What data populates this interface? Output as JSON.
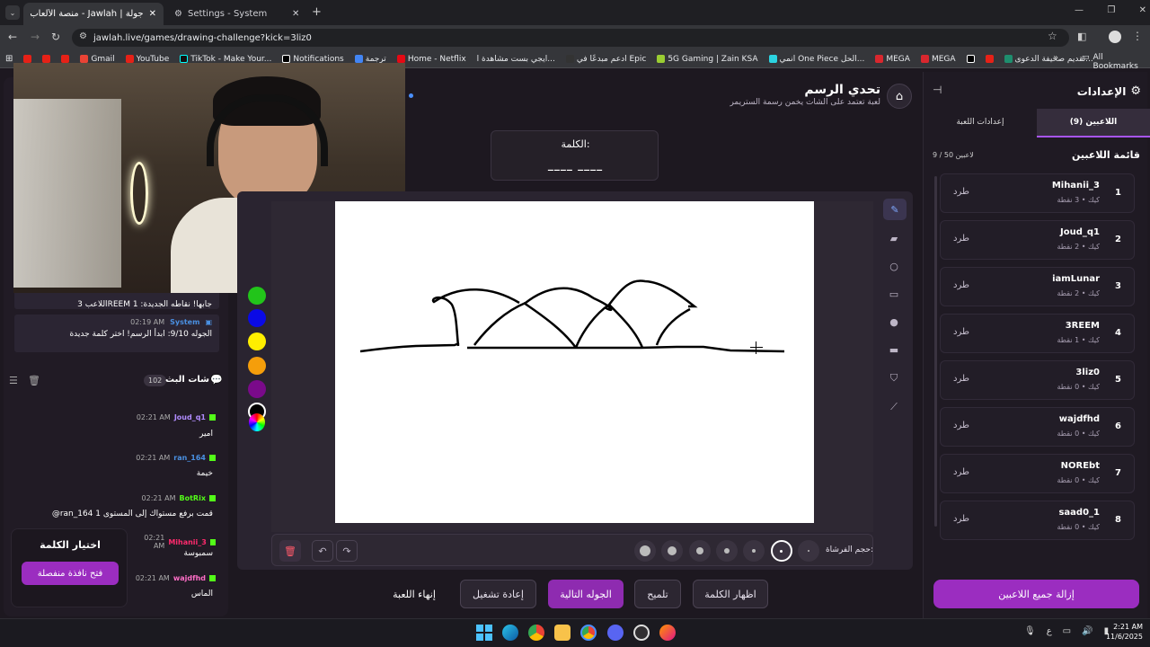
{
  "browser": {
    "tabs": [
      {
        "label": "جولة | Jawlah - منصة الألعاب الـ..."
      },
      {
        "label": "Settings - System"
      }
    ],
    "url": "jawlah.live/games/drawing-challenge?kick=3liz0",
    "bookmarks": [
      "Gmail",
      "YouTube",
      "TikTok - Make Your...",
      "Notifications",
      "ترجمة",
      "Home - Netflix",
      "ايجي بست مشاهدة ا...",
      "ادعم مبدعًا في Epic",
      "5G Gaming | Zain KSA",
      "انمي One Piece الحل...",
      "MEGA",
      "MEGA",
      "تقديم صحيفة الدعوى..."
    ],
    "all_bookmarks": "All Bookmarks"
  },
  "game": {
    "title": "تحدي الرسم",
    "subtitle": "لعبة تعتمد على الشات يخمن رسمة الستريمر",
    "word_label": "الكلمة:",
    "word_mask": "____ ____",
    "brush_size_label": "حجم الفرشاة:",
    "buttons": {
      "show_word": "اظهار الكلمة",
      "hint": "تلميح",
      "next_round": "الجوله التالية",
      "restart": "إعادة تشغيل",
      "end_game": "إنهاء اللعبة"
    },
    "colors": [
      "#22c41a",
      "#0a0ae6",
      "#ffee00",
      "#f59e0b",
      "#7a0a8a"
    ]
  },
  "system_messages": [
    {
      "text": "اللاعب 3REEM جابها! نقاطه الجديدة: 1"
    },
    {
      "name": "System",
      "time": "02:19 AM",
      "text": "الجوله 9/10: ابدأ الرسم! اختر كلمة جديدة"
    }
  ],
  "chat": {
    "title": "شات البث",
    "count": "102",
    "messages": [
      {
        "name": "Joud_q1",
        "time": "02:21 AM",
        "text": "امير",
        "color": "#b18cff"
      },
      {
        "name": "ran_164",
        "time": "02:21 AM",
        "text": "خيمة",
        "color": "#4a90e2"
      },
      {
        "name": "BotRix",
        "time": "02:21 AM",
        "text": "@ran_164 قمت برفع مستواك إلى المستوى 1",
        "color": "#53fc18"
      },
      {
        "name": "Mihanii_3",
        "time": "02:21 AM",
        "text": "سمبوسة",
        "color": "#ff2a6d"
      },
      {
        "name": "wajdfhd",
        "time": "02:21 AM",
        "text": "الماس",
        "color": "#ff6ec7"
      }
    ]
  },
  "choose_word": {
    "title": "اختيار الكلمة",
    "button": "فتح نافذة منفصلة"
  },
  "settings": {
    "title": "الإعدادات",
    "tab_players": "اللاعبين (9)",
    "tab_game": "إعدادات اللعبة",
    "list_title": "قائمة اللاعبين",
    "count": "9 / 50 لاعبين",
    "kick_label": "طرد",
    "remove_all": "إزالة جميع اللاعبين",
    "players": [
      {
        "num": "1",
        "name": "Mihanii_3",
        "sub": "كيك • 3 نقطة"
      },
      {
        "num": "2",
        "name": "Joud_q1",
        "sub": "كيك • 2 نقطة"
      },
      {
        "num": "3",
        "name": "iamLunar",
        "sub": "كيك • 2 نقطة"
      },
      {
        "num": "4",
        "name": "3REEM",
        "sub": "كيك • 1 نقطة"
      },
      {
        "num": "5",
        "name": "3liz0",
        "sub": "كيك • 0 نقطة"
      },
      {
        "num": "6",
        "name": "wajdfhd",
        "sub": "كيك • 0 نقطة"
      },
      {
        "num": "7",
        "name": "NOREbt",
        "sub": "كيك • 0 نقطة"
      },
      {
        "num": "8",
        "name": "saad0_1",
        "sub": "كيك • 0 نقطة"
      }
    ]
  },
  "taskbar": {
    "lang": "ع",
    "time": "2:21 AM",
    "date": "11/6/2025"
  }
}
